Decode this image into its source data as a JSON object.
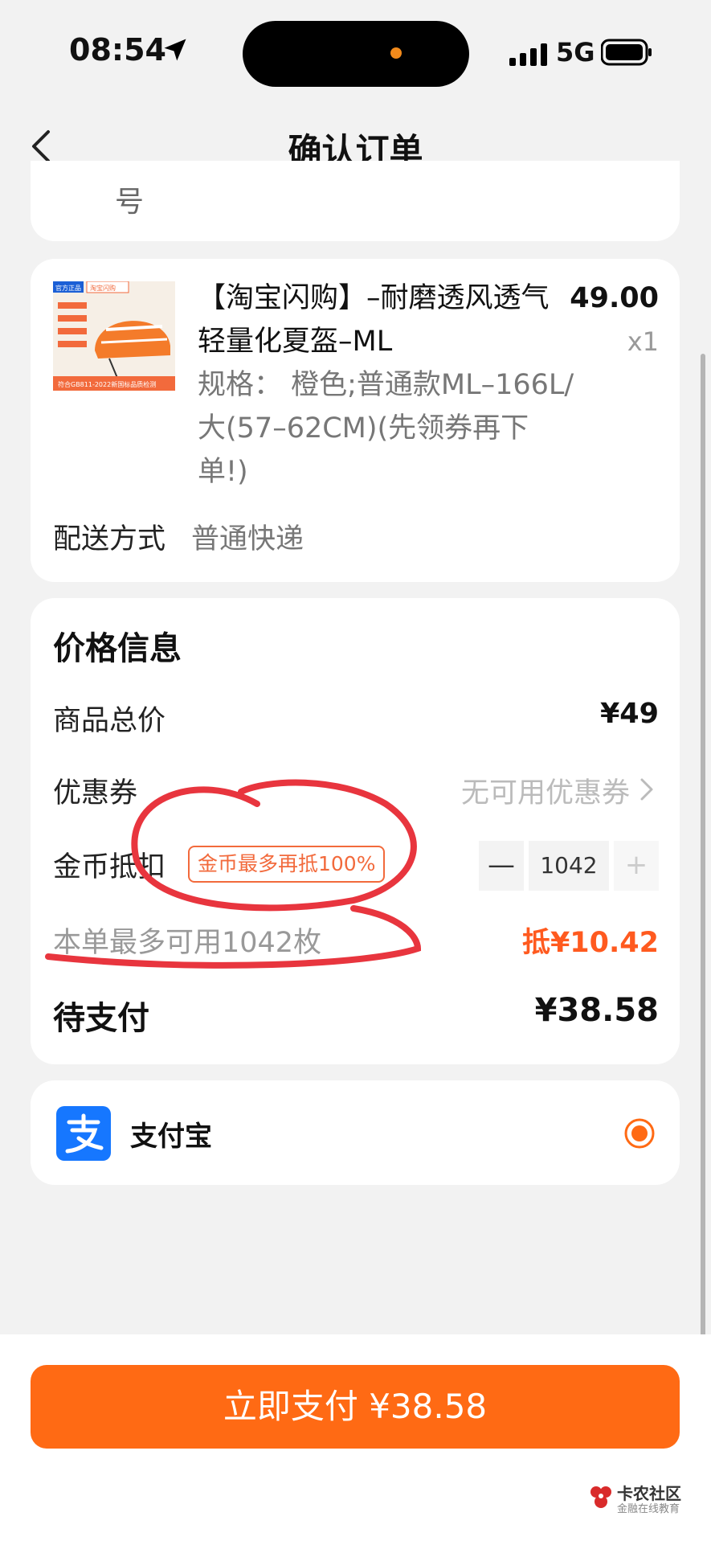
{
  "status_bar": {
    "time": "08:54",
    "network": "5G"
  },
  "nav": {
    "title": "确认订单"
  },
  "partial": {
    "text": "号"
  },
  "product": {
    "image_labels": {
      "tag": "官方正品",
      "brand": "淘宝闪购",
      "cert": "符合GB811-2022新国标品质检测"
    },
    "title": "【淘宝闪购】–耐磨透风透气轻量化夏盔–ML",
    "price": "49.00",
    "qty": "x1",
    "spec": "规格：  橙色;普通款ML–166L/大(57–62CM)(先领券再下单!)",
    "shipping_label": "配送方式",
    "shipping_value": "普通快递"
  },
  "price_info": {
    "title": "价格信息",
    "total_label": "商品总价",
    "total_value": "¥49",
    "coupon_label": "优惠券",
    "coupon_value": "无可用优惠券",
    "coin_label": "金币抵扣",
    "coin_badge": "金币最多再抵100%",
    "stepper": {
      "minus": "—",
      "value": "1042",
      "plus": "+"
    },
    "max_use": "本单最多可用1042枚",
    "discount": "抵¥10.42",
    "due_label": "待支付",
    "due_value": "¥38.58"
  },
  "payment": {
    "method": "支付宝",
    "selected": true
  },
  "pay_button": {
    "label": "立即支付 ¥38.58"
  },
  "watermark": {
    "name": "卡农社区",
    "sub": "金融在线教育"
  },
  "colors": {
    "accent": "#ff6a14",
    "discount": "#ff5a1f",
    "alipay": "#1677ff",
    "annotation": "#e8353e"
  }
}
